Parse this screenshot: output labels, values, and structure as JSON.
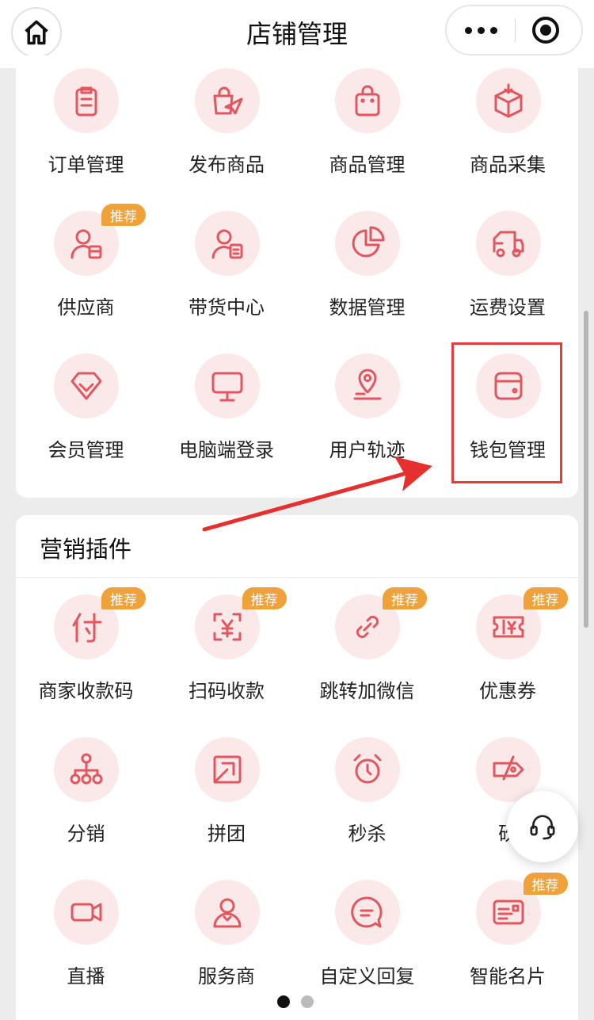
{
  "header": {
    "title": "店铺管理",
    "home_icon": "home-icon",
    "more_icon": "more-dots-icon",
    "close_icon": "capsule-close-icon"
  },
  "store_tools": [
    {
      "label": "订单管理",
      "icon": "clipboard-icon"
    },
    {
      "label": "发布商品",
      "icon": "bag-send-icon"
    },
    {
      "label": "商品管理",
      "icon": "shopping-bag-icon"
    },
    {
      "label": "商品采集",
      "icon": "box-download-icon"
    },
    {
      "label": "供应商",
      "icon": "user-box-icon",
      "badge": "推荐"
    },
    {
      "label": "带货中心",
      "icon": "user-doc-icon"
    },
    {
      "label": "数据管理",
      "icon": "pie-chart-icon"
    },
    {
      "label": "运费设置",
      "icon": "truck-icon"
    },
    {
      "label": "会员管理",
      "icon": "diamond-icon"
    },
    {
      "label": "电脑端登录",
      "icon": "monitor-icon"
    },
    {
      "label": "用户轨迹",
      "icon": "location-pin-icon"
    },
    {
      "label": "钱包管理",
      "icon": "wallet-icon"
    }
  ],
  "marketing": {
    "title": "营销插件",
    "items": [
      {
        "label": "商家收款码",
        "icon": "pay-char-icon",
        "badge": "推荐"
      },
      {
        "label": "扫码收款",
        "icon": "scan-yen-icon",
        "badge": "推荐"
      },
      {
        "label": "跳转加微信",
        "icon": "link-icon",
        "badge": "推荐"
      },
      {
        "label": "优惠券",
        "icon": "coupon-icon",
        "badge": "推荐"
      },
      {
        "label": "分销",
        "icon": "hierarchy-icon"
      },
      {
        "label": "拼团",
        "icon": "group-frame-icon"
      },
      {
        "label": "秒杀",
        "icon": "alarm-clock-icon"
      },
      {
        "label": "砍",
        "icon": "tag-cut-icon"
      },
      {
        "label": "直播",
        "icon": "video-camera-icon"
      },
      {
        "label": "服务商",
        "icon": "service-person-icon"
      },
      {
        "label": "自定义回复",
        "icon": "chat-bubble-icon"
      },
      {
        "label": "智能名片",
        "icon": "business-card-icon",
        "badge": "推荐"
      }
    ]
  },
  "pagination": {
    "current": 1,
    "total": 2
  },
  "floating": {
    "service_icon": "headset-icon"
  },
  "colors": {
    "accent": "#e0575f",
    "icon_bg": "#fbe8e9",
    "badge": "#f0a23a",
    "highlight": "#e53b3b"
  }
}
